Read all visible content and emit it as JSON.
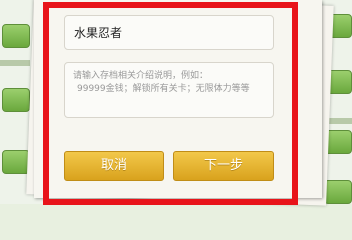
{
  "dialog": {
    "save_name_value": "水果忍者",
    "description_placeholder_line1": "请输入存档相关介绍说明，例如：",
    "description_placeholder_line2": "99999金钱；解锁所有关卡；无限体力等等",
    "cancel_label": "取消",
    "next_label": "下一步"
  },
  "colors": {
    "highlight": "#e8141a",
    "button": "#e6b431"
  }
}
